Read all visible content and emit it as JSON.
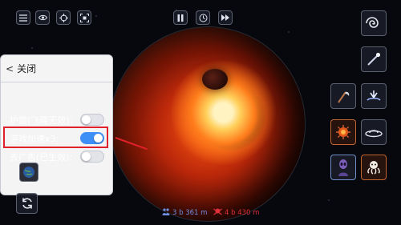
{
  "settings_panel": {
    "back_label": "关闭",
    "rows": [
      {
        "label": "护盾(飞碟无效):",
        "enabled": false
      },
      {
        "label": "游戏加速x3:",
        "enabled": true
      },
      {
        "label": "去广告(已生效):",
        "enabled": false
      }
    ]
  },
  "status_bar": {
    "population": "3 b 361 m",
    "threat": "4 b 430 m",
    "population_color": "#6f8fe0",
    "threat_color": "#e0303a"
  },
  "top_left_icons": [
    "menu-icon",
    "eye-icon",
    "crosshair-icon",
    "screenshot-icon"
  ],
  "top_center_icons": [
    "pause-icon",
    "clock-icon",
    "fast-forward-icon"
  ],
  "right_icons": [
    "galaxy-icon",
    "comet-icon",
    "scythe-icon",
    "shockwave-icon",
    "fireball-icon",
    "ufo-icon",
    "alien-icon",
    "octopus-icon"
  ],
  "accent_colors": {
    "toggle_on": "#3e8ff6",
    "highlight": "#e0202a"
  }
}
